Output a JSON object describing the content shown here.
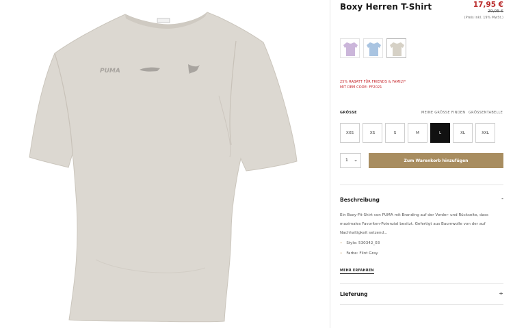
{
  "product": {
    "title": "Boxy Herren T-Shirt",
    "price": "17,95 €",
    "old_price": "29,95 €",
    "vat_note": "(Preis inkl. 19% MwSt.)",
    "color_hex": "#dcd8d1"
  },
  "swatches": [
    {
      "name": "lavender",
      "color": "#cbb6da"
    },
    {
      "name": "light-blue",
      "color": "#a9c4e1"
    },
    {
      "name": "flint-gray",
      "color": "#d6d1c6"
    }
  ],
  "promo": {
    "line1": "25% RABATT FÜR FRIENDS & FAMILY*",
    "line2": "MIT DEM CODE: FF2021"
  },
  "sizes": {
    "label": "GRÖSSE",
    "find_link": "MEINE GRÖSSE FINDEN",
    "table_link": "GRÖSSENTABELLE",
    "options": [
      "XXS",
      "XS",
      "S",
      "M",
      "L",
      "XL",
      "XXL"
    ],
    "selected": "L"
  },
  "cart": {
    "quantity": "1",
    "button_label": "Zum Warenkorb hinzufügen"
  },
  "description": {
    "title": "Beschreibung",
    "toggle": "-",
    "text": "Ein Boxy-Fit-Shirt von PUMA mit Branding auf der Vorder- und Rückseite, dass maximales Favoriten-Potenzial besitzt. Gefertigt aus Baumwolle von der auf Nachhaltigkeit setzend...",
    "bullets": [
      "Style: 530342_03",
      "Farbe: Flint Gray"
    ],
    "more": "MEHR ERFAHREN"
  },
  "delivery": {
    "title": "Lieferung",
    "toggle": "+"
  },
  "colors": {
    "accent_gold": "#a88d60",
    "sale_red": "#c6262c",
    "selected_size_bg": "#111111"
  },
  "icons": {
    "quantity_chevron": "chevron-down-icon"
  }
}
